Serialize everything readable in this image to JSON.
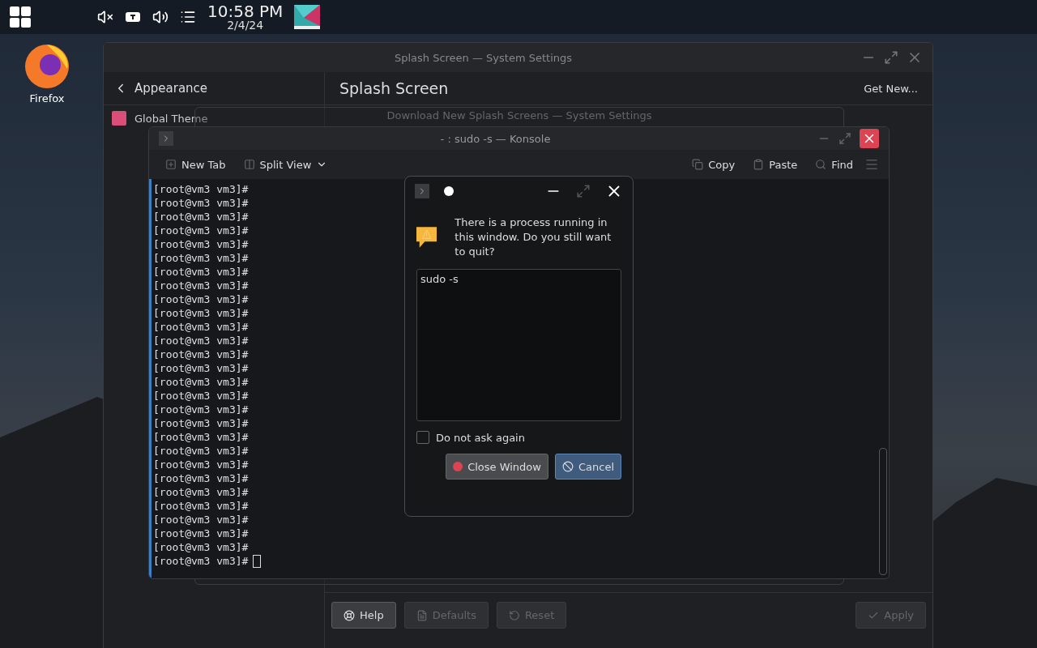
{
  "panel": {
    "time": "10:58 PM",
    "date": "2/4/24"
  },
  "desktop_icons": [
    {
      "label": "Firefox"
    }
  ],
  "settings_window": {
    "title": "Splash Screen — System Settings",
    "back_label": "Appearance",
    "page_title": "Splash Screen",
    "get_new": "Get New...",
    "sidebar_items": [
      {
        "label": "Global Theme",
        "selected": false
      }
    ],
    "footer_buttons_left": [
      {
        "label": "Help",
        "disabled": false
      },
      {
        "label": "Defaults",
        "disabled": true
      },
      {
        "label": "Reset",
        "disabled": true
      }
    ],
    "footer_buttons_right": [
      {
        "label": "Apply",
        "disabled": true
      }
    ]
  },
  "download_window": {
    "title": "Download New Splash Screens — System Settings"
  },
  "konsole": {
    "title": "- : sudo -s — Konsole",
    "toolbar_left": [
      {
        "label": "New Tab"
      },
      {
        "label": "Split View"
      }
    ],
    "toolbar_right": [
      {
        "label": "Copy"
      },
      {
        "label": "Paste"
      },
      {
        "label": "Find"
      }
    ],
    "lines": [
      "[root@vm3 vm3]#",
      "[root@vm3 vm3]#",
      "[root@vm3 vm3]#",
      "[root@vm3 vm3]#",
      "[root@vm3 vm3]#",
      "[root@vm3 vm3]#",
      "[root@vm3 vm3]#",
      "[root@vm3 vm3]#",
      "[root@vm3 vm3]#",
      "[root@vm3 vm3]#",
      "[root@vm3 vm3]#",
      "[root@vm3 vm3]#",
      "[root@vm3 vm3]#",
      "[root@vm3 vm3]#",
      "[root@vm3 vm3]#",
      "[root@vm3 vm3]#",
      "[root@vm3 vm3]#",
      "[root@vm3 vm3]#",
      "[root@vm3 vm3]#",
      "[root@vm3 vm3]#",
      "[root@vm3 vm3]#",
      "[root@vm3 vm3]#",
      "[root@vm3 vm3]#",
      "[root@vm3 vm3]#",
      "[root@vm3 vm3]#",
      "[root@vm3 vm3]#",
      "[root@vm3 vm3]#",
      "[root@vm3 vm3]#"
    ]
  },
  "dialog": {
    "message": "There is a process running in this window. Do you still want to quit?",
    "details": "sudo -s",
    "checkbox": {
      "label": "Do not ask again",
      "checked": false
    },
    "buttons": [
      {
        "label": "Close Window",
        "kind": "destructive"
      },
      {
        "label": "Cancel",
        "kind": "default"
      }
    ]
  }
}
